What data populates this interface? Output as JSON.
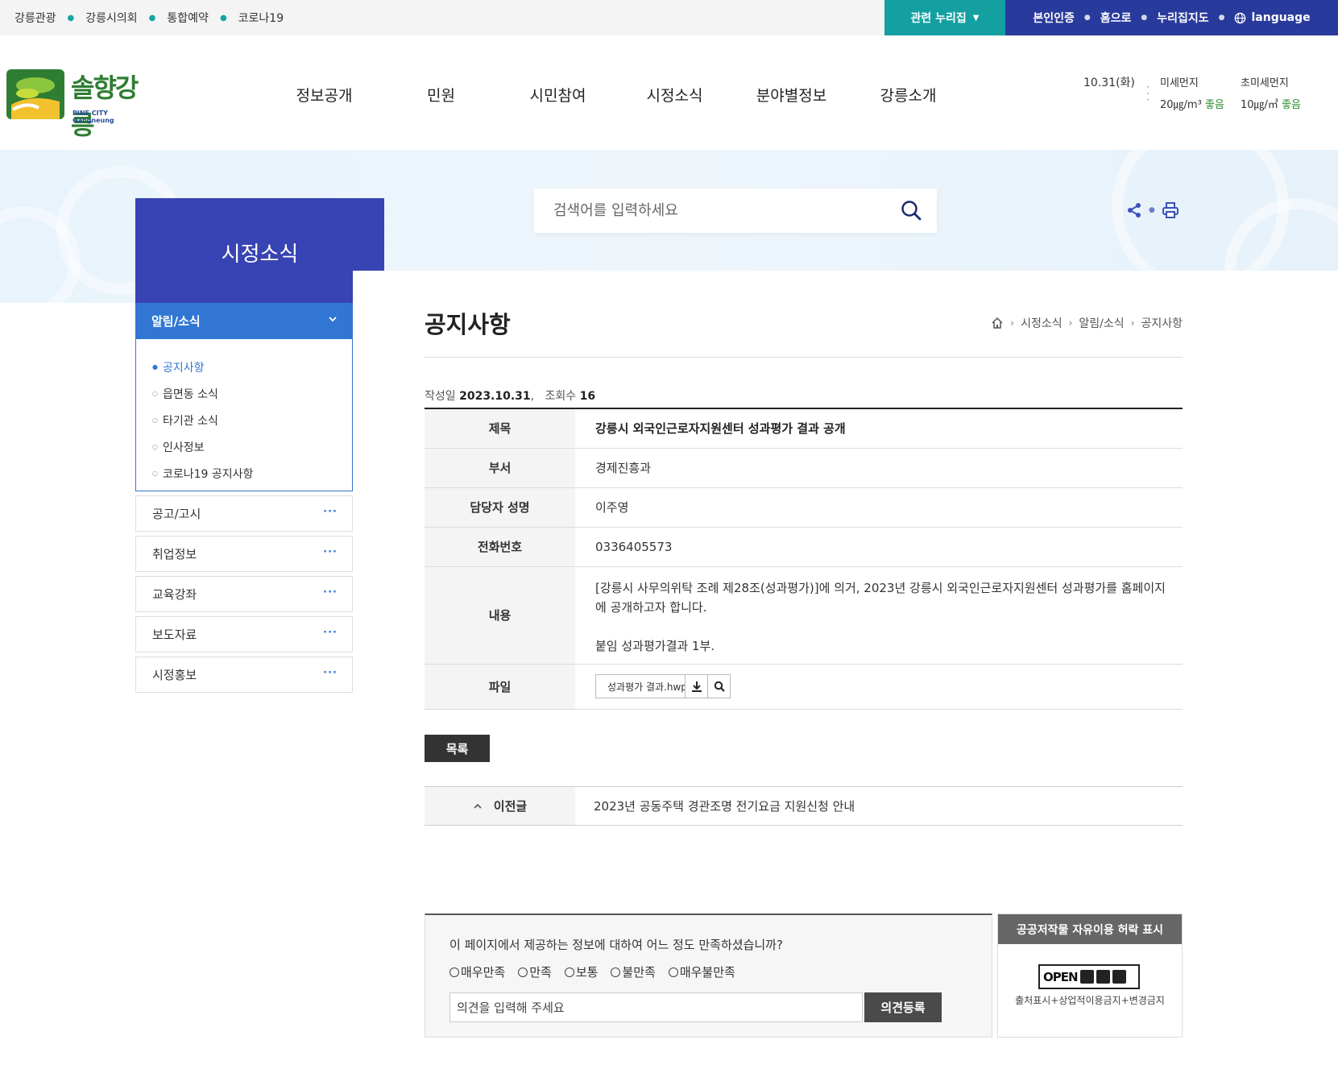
{
  "top_links": [
    "강릉관광",
    "강릉시의회",
    "통합예약",
    "코로나19"
  ],
  "related_sites_label": "관련 누리집",
  "top_right": {
    "auth": "본인인증",
    "home": "홈으로",
    "sitemap": "누리집지도",
    "language": "language"
  },
  "logo": {
    "title": "솔향강릉",
    "subtitle": "PINE CITY Gangneung"
  },
  "gnb": [
    "정보공개",
    "민원",
    "시민참여",
    "시정소식",
    "분야별정보",
    "강릉소개"
  ],
  "weather": {
    "date": "10.31(화)",
    "pm10": {
      "label": "미세먼지",
      "value": "20㎍/m³",
      "status": "좋음"
    },
    "pm25": {
      "label": "초미세먼지",
      "value": "10㎍/㎥",
      "status": "좋음"
    }
  },
  "search": {
    "placeholder": "검색어를 입력하세요"
  },
  "lnb": {
    "title": "시정소식",
    "open_menu": "알림/소식",
    "sub_items": [
      "공지사항",
      "읍면동 소식",
      "타기관 소식",
      "인사정보",
      "코로나19 공지사항"
    ],
    "items": [
      "공고/고시",
      "취업정보",
      "교육강좌",
      "보도자료",
      "시정홍보"
    ]
  },
  "page": {
    "title": "공지사항",
    "breadcrumb": [
      "시정소식",
      "알림/소식",
      "공지사항"
    ]
  },
  "meta": {
    "date_label": "작성일",
    "date": "2023.10.31",
    "views_label": "조회수",
    "views": "16"
  },
  "post": {
    "subject_label": "제목",
    "subject": "강릉시 외국인근로자지원센터 성과평가 결과 공개",
    "dept_label": "부서",
    "dept": "경제진흥과",
    "manager_label": "담당자 성명",
    "manager": "이주영",
    "phone_label": "전화번호",
    "phone": "0336405573",
    "content_label": "내용",
    "content_line1": "[강릉시 사무의위탁 조례 제28조(성과평가)]에 의거, 2023년 강릉시 외국인근로자지원센터 성과평가를 홈페이지에 공개하고자 합니다.",
    "content_line2": "붙임 성과평가결과 1부.",
    "file_label": "파일",
    "file_name": "성과평가 결과.hwp"
  },
  "list_button": "목록",
  "prev_post": {
    "label": "이전글",
    "title": "2023년 공동주택 경관조명 전기요금 지원신청 안내"
  },
  "survey": {
    "question": "이 페이지에서 제공하는 정보에 대하여 어느 정도 만족하셨습니까?",
    "options": [
      "매우만족",
      "만족",
      "보통",
      "불만족",
      "매우불만족"
    ],
    "placeholder": "의견을 입력해 주세요",
    "submit": "의견등록"
  },
  "license": {
    "title": "공공저작물 자유이용 허락 표시",
    "badge": "OPEN",
    "text": "출처표시+상업적이용금지+변경금지"
  },
  "colors": {
    "navy": "#283a9c",
    "teal": "#14a0a0",
    "lnb_blue": "#3276d3",
    "lnb_title": "#3844b3"
  }
}
